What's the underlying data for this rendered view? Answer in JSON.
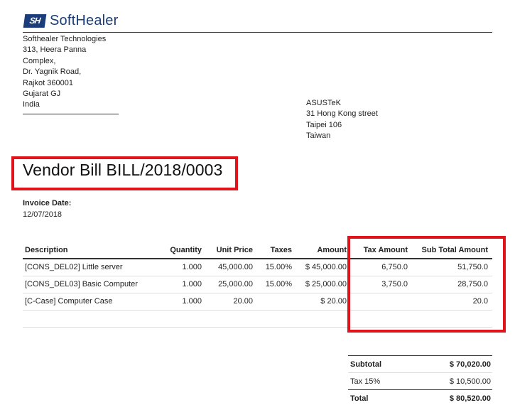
{
  "brand": {
    "mark": "SH",
    "name": "SoftHealer",
    "color": "#1b3d7a"
  },
  "company": {
    "lines": [
      "Softhealer Technologies",
      "313, Heera Panna Complex,",
      "Dr. Yagnik Road,",
      "Rajkot 360001",
      "Gujarat GJ",
      "India"
    ]
  },
  "partner": {
    "lines": [
      "ASUSTeK",
      "31 Hong Kong street",
      "Taipei 106",
      "Taiwan"
    ]
  },
  "document": {
    "title": "Vendor Bill BILL/2018/0003",
    "invoice_date_label": "Invoice Date:",
    "invoice_date": "12/07/2018"
  },
  "lines_table": {
    "headers": [
      "Description",
      "Quantity",
      "Unit Price",
      "Taxes",
      "Amount",
      "Tax Amount",
      "Sub Total Amount"
    ],
    "rows": [
      [
        "[CONS_DEL02] Little server",
        "1.000",
        "45,000.00",
        "15.00%",
        "$ 45,000.00",
        "6,750.0",
        "51,750.0"
      ],
      [
        "[CONS_DEL03] Basic Computer",
        "1.000",
        "25,000.00",
        "15.00%",
        "$ 25,000.00",
        "3,750.0",
        "28,750.0"
      ],
      [
        "[C-Case] Computer Case",
        "1.000",
        "20.00",
        "",
        "$ 20.00",
        "",
        "20.0"
      ]
    ]
  },
  "totals": {
    "subtotal_label": "Subtotal",
    "subtotal": "$ 70,020.00",
    "tax_label": "Tax 15%",
    "tax": "$ 10,500.00",
    "total_label": "Total",
    "total": "$ 80,520.00"
  },
  "highlight_color": "#e0141b"
}
